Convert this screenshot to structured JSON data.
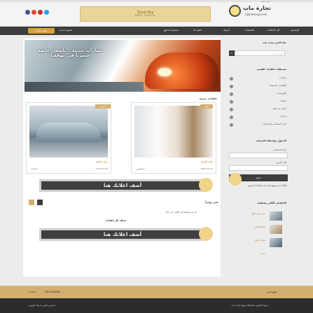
{
  "topbar": {
    "text": "تجارة ماب"
  },
  "header": {
    "logo_text": "تجارة ماب",
    "logo_sub": "tijarahmap.com",
    "banner_line1": "Tijarah Map",
    "banner_line2": "ADS SPACE"
  },
  "nav": {
    "items": [
      "الرئيسية",
      "كل الإعلانات",
      "الصفحات",
      "الدولة",
      "اعمل لنا",
      "تسجيل الدخول"
    ],
    "add_button": "أضف اعلانك",
    "register": "عضوية جديدة"
  },
  "hero": {
    "text": "سيارات حديثة .. بأسعار خاصة حصرياً في موقعنا"
  },
  "main": {
    "featured_title": "إعلانات مميزة",
    "cards": [
      {
        "title": "شقة للإيجار",
        "meta_date": "2020-04-22",
        "meta_loc": "أم القيوين",
        "tag": "شقق"
      },
      {
        "title": "سيارة للبيع",
        "meta_date": "2015-05-06",
        "meta_loc": "الشارقة",
        "tag": "سيارات"
      }
    ],
    "ad_text": "أضف اعلانك هنا",
    "latest_title": "نشر مؤخراً",
    "no_ads_text": "لم تتم إضافة أي اعلان حتى الآن",
    "view_all": "شاهد كل إعلانات",
    "ad_text2": "أضف اعلانك هنا"
  },
  "sidebar": {
    "search_title": "ماذا الذي تبحث عنه",
    "search_placeholder": "ابحث عن...",
    "categories_title": "تصنيفات اعلانات القسم",
    "categories": [
      "سيارات",
      "العقارات المتنوعة",
      "إلكترونيات",
      "معدات",
      "اعمل من البيت",
      "خدمات",
      "دليل المنشأت والشركات"
    ],
    "login_title": "الدخول بواسطة الحسابة",
    "login_user_label": "اسم المستخدم",
    "login_pass_label": "كلمة المرور",
    "login_button": "دخول",
    "login_note": "أهلاً بك في موقع تجارة ماب للإعلانات المبوبة",
    "recent_title": "الإعلانات الأكثر مشاهدة",
    "recent": [
      "منزل كبير للبيع",
      "شقة للإيجار",
      "سيارة للبيع",
      "دراجة"
    ]
  },
  "footer": {
    "left1": "حقوق النشر",
    "left2": "اتصل بنا",
    "phone": "0501-XXXXXX",
    "copyright": "جميع الحقوق محفوظة لموقع تجارة ماب",
    "powered": "تصميم وتطوير شركة تكنوويب"
  },
  "colors": {
    "accent": "#d4b070",
    "nav": "#3d3d3d",
    "footer": "#2c2c2c"
  }
}
